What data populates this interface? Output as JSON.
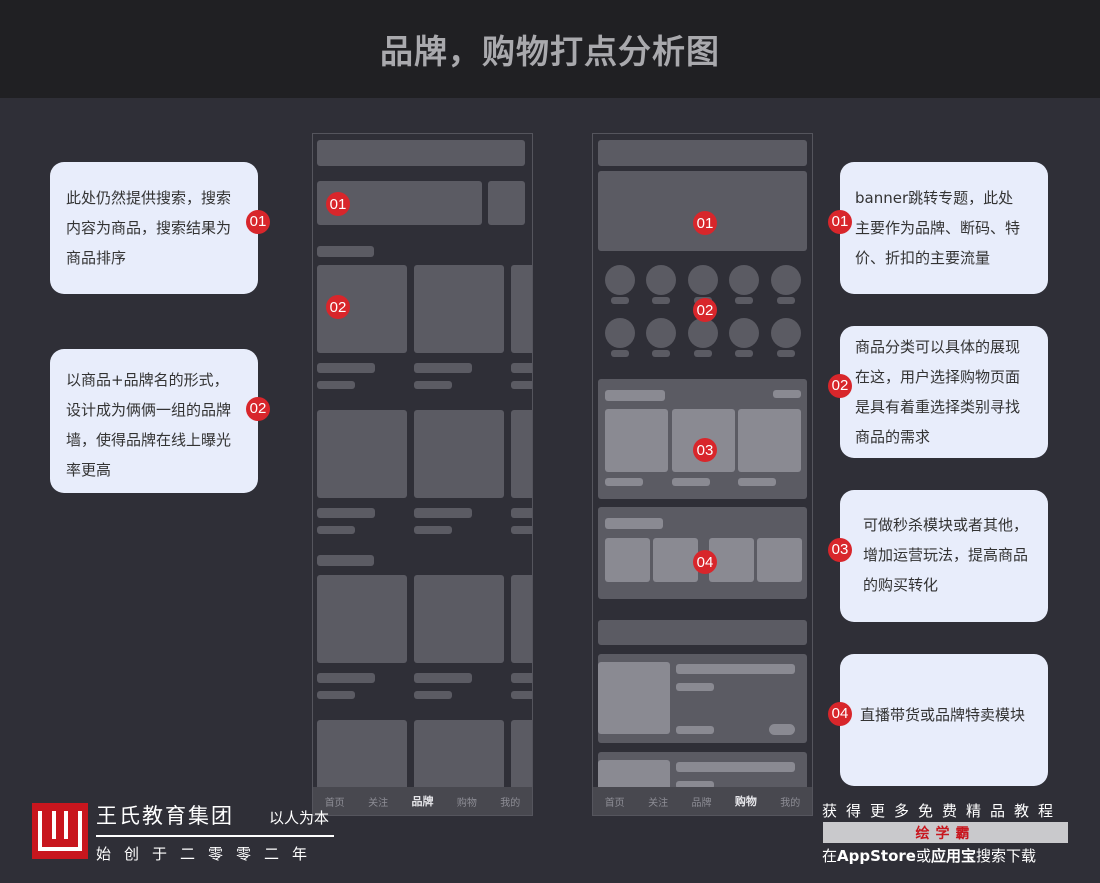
{
  "title": "品牌，购物打点分析图",
  "left_phone": {
    "markers": [
      "01",
      "02"
    ],
    "tabs": [
      "首页",
      "关注",
      "品牌",
      "购物",
      "我的"
    ],
    "active_tab": "品牌"
  },
  "right_phone": {
    "markers": [
      "01",
      "02",
      "03",
      "04"
    ],
    "tabs": [
      "首页",
      "关注",
      "品牌",
      "购物",
      "我的"
    ],
    "active_tab": "购物"
  },
  "left_cards": [
    {
      "marker": "01",
      "lines": [
        "此处仍然提供搜索，搜索",
        "内容为商品，搜索结果为",
        "商品排序"
      ]
    },
    {
      "marker": "02",
      "lines": [
        "以商品+品牌名的形式，",
        "设计成为俩俩一组的品牌",
        "墙，使得品牌在线上曝光",
        "率更高"
      ]
    }
  ],
  "right_cards": [
    {
      "marker": "01",
      "lines": [
        "banner跳转专题，此处",
        "主要作为品牌、断码、特",
        "价、折扣的主要流量"
      ]
    },
    {
      "marker": "02",
      "lines": [
        "商品分类可以具体的展现",
        "在这，用户选择购物页面",
        "是具有着重选择类别寻找",
        "商品的需求"
      ]
    },
    {
      "marker": "03",
      "lines": [
        "可做秒杀模块或者其他，",
        "增加运营玩法，提高商品",
        "的购买转化"
      ]
    },
    {
      "marker": "04",
      "lines": [
        "直播带货或品牌特卖模块"
      ]
    }
  ],
  "footer": {
    "brand_name": "王氏教育集团",
    "slogan": "以人为本",
    "since": "始创于二零零二年",
    "promo_line1": "获得更多免费精品教程",
    "promo_badge": "绘学霸",
    "promo_line2_pre": "在",
    "promo_line2_appstore": "AppStore",
    "promo_line2_mid": "或",
    "promo_line2_yyb": "应用宝",
    "promo_line2_post": "搜索下载"
  },
  "colors": {
    "background": "#2f2f37",
    "header": "#202023",
    "marker": "#d8262b",
    "card": "#e8edfb",
    "brand_red": "#c8161e"
  }
}
